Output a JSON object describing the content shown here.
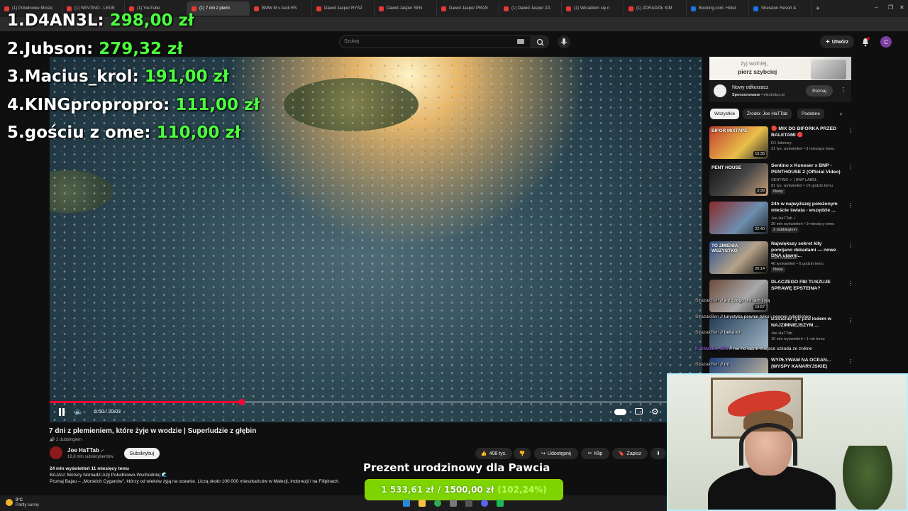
{
  "browser": {
    "tabs": [
      {
        "label": "(1) Połudnowe Mroze",
        "color": "#e53935"
      },
      {
        "label": "(1) SENTINO - LEGE",
        "color": "#e53935"
      },
      {
        "label": "(1) YouTube",
        "color": "#e53935"
      },
      {
        "label": "(1) 7 dni z plemi",
        "color": "#e53935",
        "active": true
      },
      {
        "label": "BMW M v Audi RS",
        "color": "#e53935"
      },
      {
        "label": "Dawid Jasper RYSZ",
        "color": "#e53935"
      },
      {
        "label": "Dawid Jasper SEN",
        "color": "#e53935"
      },
      {
        "label": "Dawid Jasper PRAN",
        "color": "#e53935"
      },
      {
        "label": "(1) Dawid Jasper ZA",
        "color": "#e53935"
      },
      {
        "label": "(1) Wkradłem się n",
        "color": "#e53935"
      },
      {
        "label": "(1) ZDRADZIŁ KIM",
        "color": "#e53935"
      },
      {
        "label": "Booking.com: Hotel",
        "color": "#1a73e8"
      },
      {
        "label": "Sheraton Resort &",
        "color": "#1a73e8"
      }
    ],
    "new_tab": "+",
    "window_controls": [
      "–",
      "❐",
      "✕"
    ]
  },
  "leaderboard": [
    {
      "rank": "1.",
      "name": "D4AN3L:",
      "amount": "298,00 zł"
    },
    {
      "rank": "2.",
      "name": "Jubson:",
      "amount": "279,32 zł"
    },
    {
      "rank": "3.",
      "name": "Macius_krol:",
      "amount": "191,00 zł"
    },
    {
      "rank": "4.",
      "name": "KINGpropropro:",
      "amount": "111,00 zł"
    },
    {
      "rank": "5.",
      "name": "gościu z ome:",
      "amount": "110,00 zł"
    }
  ],
  "header": {
    "search_placeholder": "Szukaj",
    "create_label": "Utwórz",
    "notif_count": "1",
    "avatar_letter": "C"
  },
  "player": {
    "time_current": "5:50",
    "time_total": "20:03",
    "progress": 0.294,
    "colors": {
      "progress": "#ff0033"
    }
  },
  "video": {
    "title": "7 dni z plemieniem, które żyje w wodzie | Superludzie z głębin",
    "dubbing": "2 dubbingiem",
    "channel": "Joe HaTTab",
    "verified": "✓",
    "subscribers": "19,8 mln subskrybentów",
    "subscribe_label": "Subskrybuj",
    "likes": "408 tys.",
    "share_label": "Udostępnij",
    "clip_label": "Klip",
    "save_label": "Zapisz",
    "description": {
      "stats": "24 mln wyświetleń  11 miesięcy temu",
      "line1": "BAJAU: Morscy Nomadzi Azji Południowo-Wschodniej 🌊",
      "line2": "Poznaj Bajau – „Morskich Cyganów”, którzy od wieków żyją na oceanie. Liczą około 100 000 mieszkańców w Malezji, Indonezji i na Filipinach."
    }
  },
  "sidebar": {
    "ad": {
      "banner_line1": "żyj wolniej,",
      "banner_line2": "pierz szybciej",
      "title": "Nowy odkurzacz",
      "sponsored": "Sponsorowane",
      "domain": "electrolux.pl",
      "cta": "Poznaj"
    },
    "chips": [
      "Wszystkie",
      "Źródło: Joe HaTTab",
      "Podobne"
    ],
    "recommendations": [
      {
        "title": "🔴 MIX DO BIFORKA PRZED BALETAMI 🔴",
        "channel": "DJ Jokeney",
        "meta": "31 tys. wyświetleń • 3 miesiące temu",
        "extra": "",
        "duration": "15:35",
        "thumb_text": "BIFOR MIXTAPE"
      },
      {
        "title": "Sentino x Koneser x BNP - PENTHOUSE 2 (Official Video)",
        "channel": "SENTINO ✓ | BNP LABEL",
        "meta": "81 tys. wyświetleń • 19 godzin temu",
        "extra": "Nowy",
        "duration": "3:39",
        "thumb_text": "PENT HOUSE"
      },
      {
        "title": "24h w najwyższej położonym mieście świata - wszędzie ...",
        "channel": "Joe HaTTab ✓",
        "meta": "30 mln wyświetleń • 9 miesięcy temu",
        "extra": "2 dubbingiem",
        "duration": "22:40",
        "thumb_text": ""
      },
      {
        "title": "Największy sekret kiły pomijano dekadami — nowe DNA ujawni...",
        "channel": "Cień Archiwum",
        "meta": "40 wyświetleń • 6 godzin temu",
        "extra": "Nowy",
        "duration": "20:14",
        "thumb_text": "TO ZMIENIA WSZYSTKO"
      },
      {
        "title": "DLACZEGO FBI TUSZUJE SPRAWĘ EPSTEINA?",
        "channel": "",
        "meta": "",
        "extra": "",
        "duration": "19:57",
        "thumb_text": ""
      },
      {
        "title": "Łowienie ryb pod lodem w NAJZIMNIEJSZYM ...",
        "channel": "Joe HaTTab",
        "meta": "16 mln wyświetleń • 1 rok temu",
        "extra": "",
        "duration": "",
        "thumb_text": ""
      },
      {
        "title": "WYPŁYWAM NA OCEAN... (WYSPY KANARYJSKIE)",
        "channel": "",
        "meta": "",
        "extra": "",
        "duration": "",
        "thumb_text": ""
      }
    ]
  },
  "chat": [
    {
      "user": "StrazakBen",
      "sep": "//",
      "message": "a z czego oni tam żyją",
      "color": "#c9c9c9"
    },
    {
      "user": "StrazakBen",
      "sep": "//",
      "message": "turystyka pewnie tylko i pewnie rybołóstwo",
      "color": "#c9c9c9"
    },
    {
      "user": "StrazakBen",
      "sep": "//",
      "message": "beka xd",
      "color": "#c9c9c9"
    },
    {
      "user": "KrolMacius_699",
      "sep": "//",
      "message": "nie no ładne miejsce szkoda ze znikne",
      "color": "#a970ff"
    },
    {
      "user": "StrazakBen",
      "sep": "//",
      "message": "mi",
      "color": "#c9c9c9"
    }
  ],
  "goal": {
    "title": "Prezent urodzinowy dla Pawcia",
    "current": "1 533,61 zł",
    "separator": "/",
    "target": "1500,00 zł",
    "percent": "(102,24%)",
    "progress": 1.0,
    "colors": {
      "fill": "#7ed400",
      "border": "#9bd400"
    }
  },
  "taskbar": {
    "temp": "9°C",
    "weather": "Partly sunny"
  }
}
